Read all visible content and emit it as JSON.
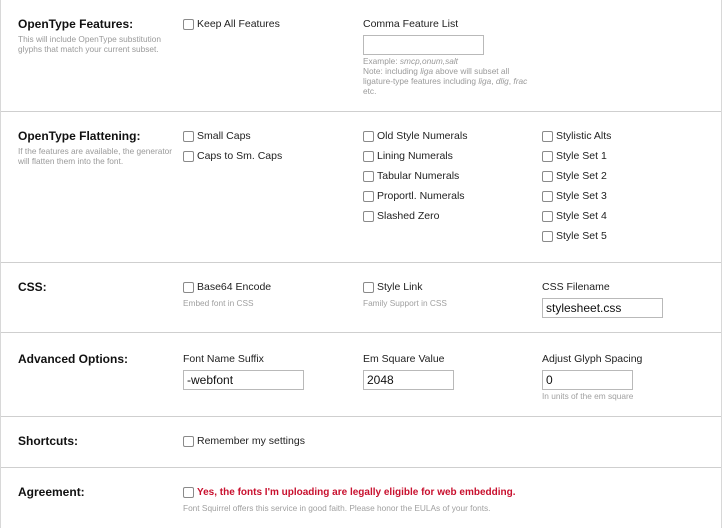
{
  "opentype_features": {
    "title": "OpenType Features:",
    "help": "This will include OpenType substitution glyphs that match your current subset.",
    "keep_all_label": "Keep All Features",
    "comma_list_label": "Comma Feature List",
    "comma_list_value": "",
    "example_prefix": "Example: ",
    "example_value": "smcp,onum,salt",
    "note_1": "Note: including ",
    "note_liga_1": "liga",
    "note_2": " above will subset all ligature-type features including ",
    "note_liga_2": "liga",
    "note_3": ", ",
    "note_dlig": "dlig",
    "note_4": ", ",
    "note_frac": "frac",
    "note_5": " etc."
  },
  "opentype_flattening": {
    "title": "OpenType Flattening:",
    "help": "If the features are available, the generator will flatten them into the font.",
    "col1": [
      "Small Caps",
      "Caps to Sm. Caps"
    ],
    "col2": [
      "Old Style Numerals",
      "Lining Numerals",
      "Tabular Numerals",
      "Proportl. Numerals",
      "Slashed Zero"
    ],
    "col3": [
      "Stylistic Alts",
      "Style Set 1",
      "Style Set 2",
      "Style Set 3",
      "Style Set 4",
      "Style Set 5"
    ]
  },
  "css": {
    "title": "CSS:",
    "base64_label": "Base64 Encode",
    "base64_sub": "Embed font in CSS",
    "style_link_label": "Style Link",
    "style_link_sub": "Family Support in CSS",
    "filename_label": "CSS Filename",
    "filename_value": "stylesheet.css"
  },
  "advanced": {
    "title": "Advanced Options:",
    "suffix_label": "Font Name Suffix",
    "suffix_value": "-webfont",
    "em_label": "Em Square Value",
    "em_value": "2048",
    "spacing_label": "Adjust Glyph Spacing",
    "spacing_value": "0",
    "spacing_sub": "In units of the em square"
  },
  "shortcuts": {
    "title": "Shortcuts:",
    "remember_label": "Remember my settings"
  },
  "agreement": {
    "title": "Agreement:",
    "agree_label": "Yes, the fonts I'm uploading are legally eligible for web embedding.",
    "agree_sub": "Font Squirrel offers this service in good faith. Please honor the EULAs of your fonts.",
    "agree_color": "#c8102e"
  }
}
